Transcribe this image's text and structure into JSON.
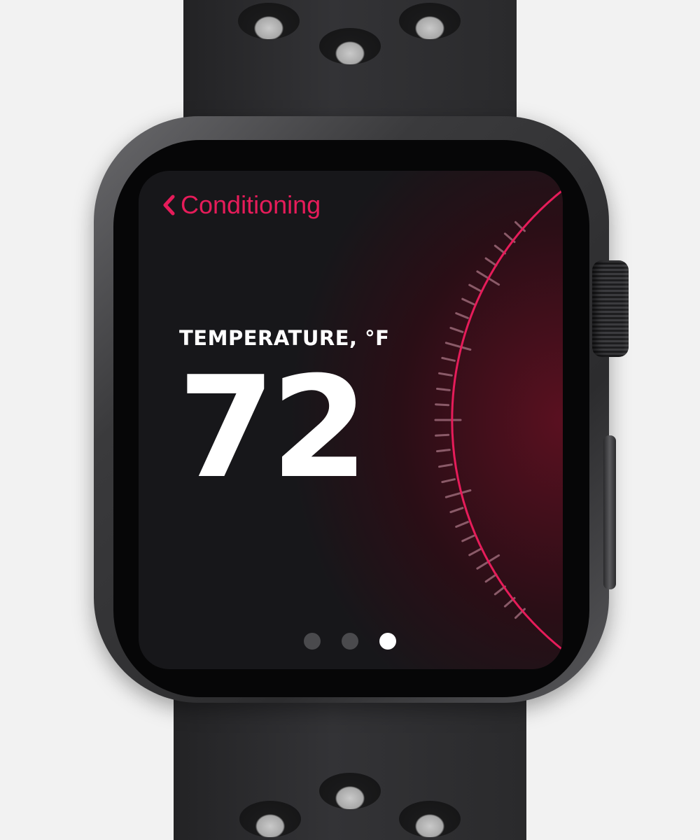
{
  "screen": {
    "back_label": "Conditioning",
    "temperature_label": "TEMPERATURE, °F",
    "temperature_value": "72",
    "page_indicator": {
      "total": 3,
      "active_index": 2
    }
  },
  "colors": {
    "accent": "#e61c5a",
    "background": "#17171a",
    "text": "#ffffff",
    "inactive_dot": "#4a4a4d"
  },
  "icons": {
    "back": "chevron-left-icon"
  }
}
